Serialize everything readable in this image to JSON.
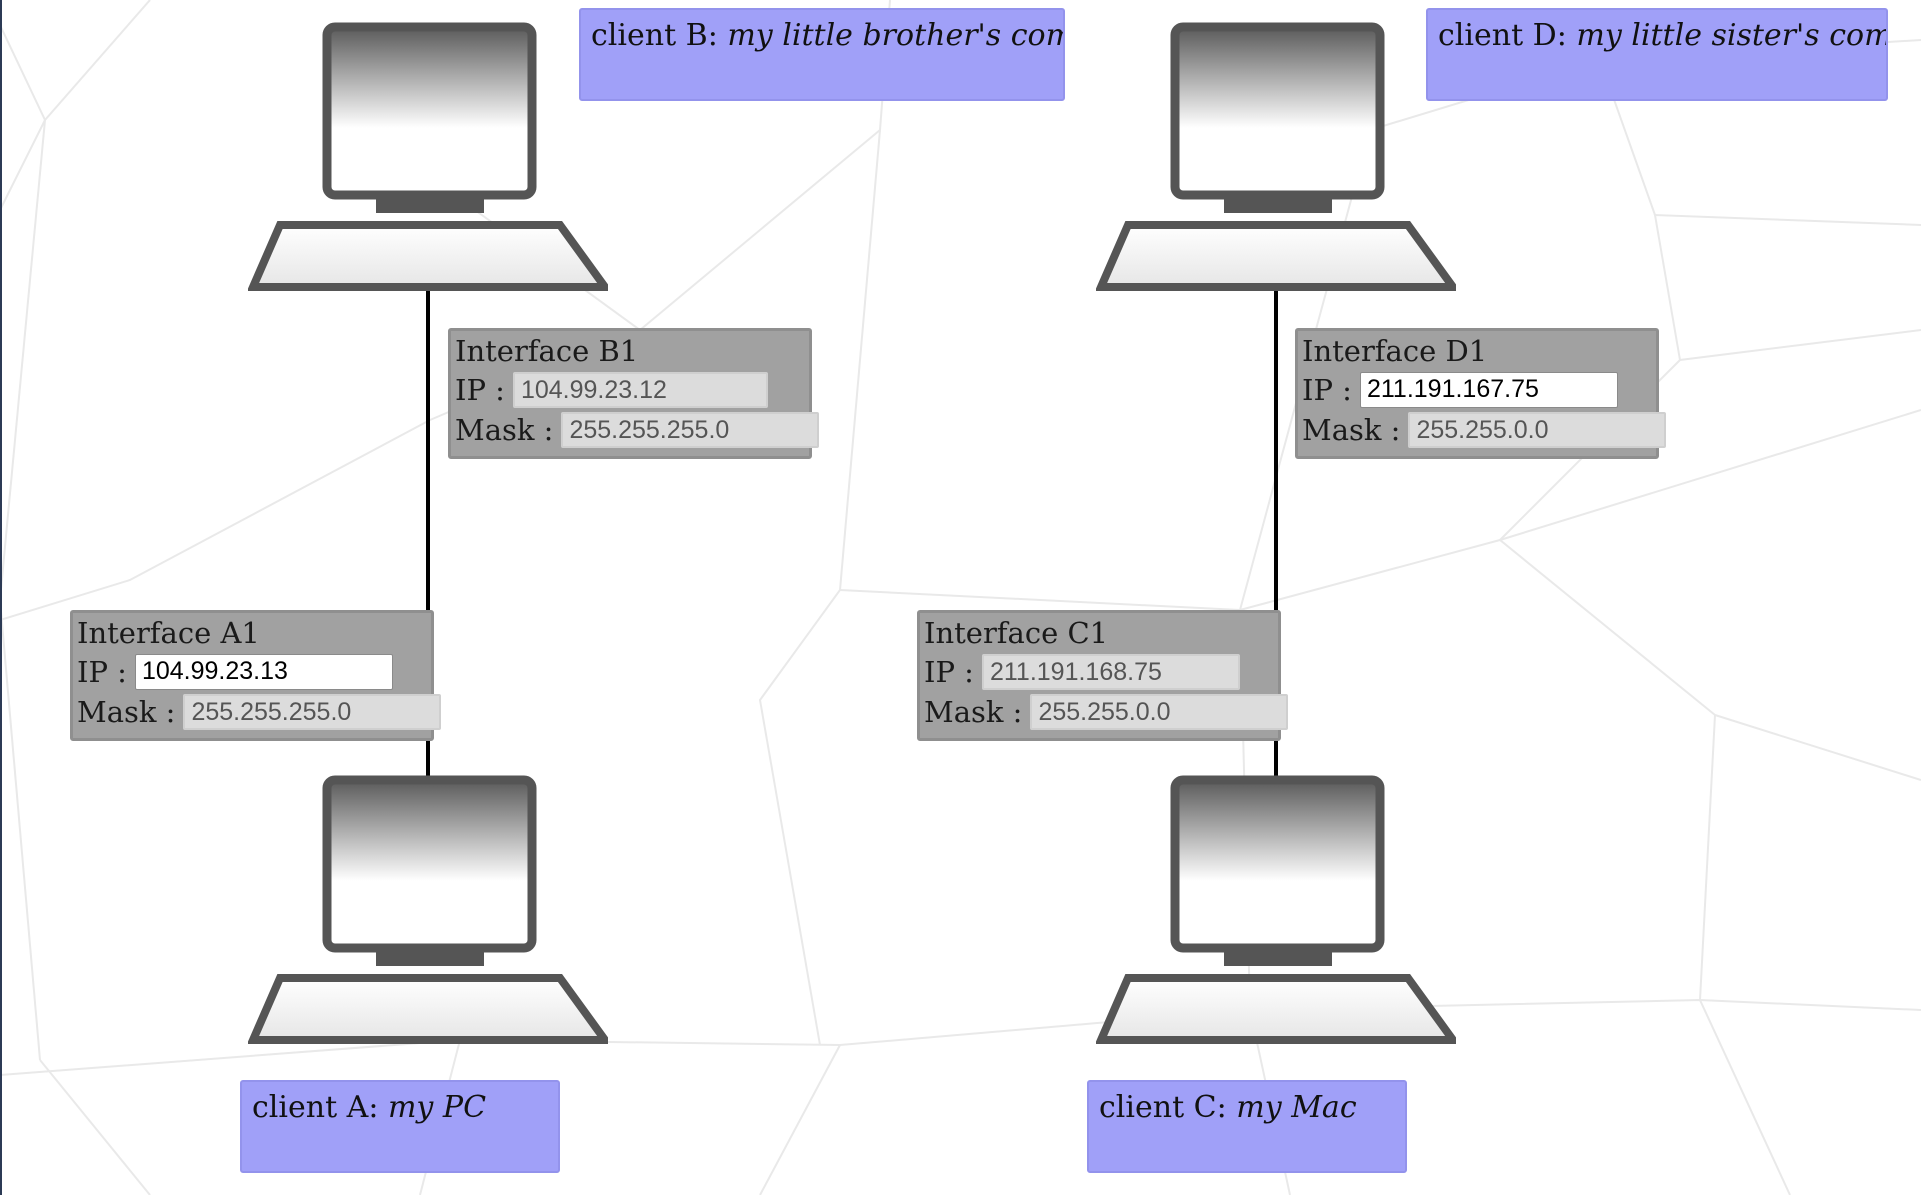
{
  "clients": {
    "a": {
      "prefix": "client A:",
      "desc": "my PC"
    },
    "b": {
      "prefix": "client B:",
      "desc": "my little brother's computer"
    },
    "c": {
      "prefix": "client C:",
      "desc": "my Mac"
    },
    "d": {
      "prefix": "client D:",
      "desc": "my little sister's computer"
    }
  },
  "interfaces": {
    "a1": {
      "title": "Interface A1",
      "ip_label": "IP :",
      "ip": "104.99.23.13",
      "ip_editable": true,
      "mask_label": "Mask :",
      "mask": "255.255.255.0"
    },
    "b1": {
      "title": "Interface B1",
      "ip_label": "IP :",
      "ip": "104.99.23.12",
      "ip_editable": false,
      "mask_label": "Mask :",
      "mask": "255.255.255.0"
    },
    "c1": {
      "title": "Interface C1",
      "ip_label": "IP :",
      "ip": "211.191.168.75",
      "ip_editable": false,
      "mask_label": "Mask :",
      "mask": "255.255.0.0"
    },
    "d1": {
      "title": "Interface D1",
      "ip_label": "IP :",
      "ip": "211.191.167.75",
      "ip_editable": true,
      "mask_label": "Mask :",
      "mask": "255.255.0.0"
    }
  },
  "colors": {
    "label_bg": "#a0a0f8",
    "interface_bg": "#a1a1a1",
    "computer_stroke": "#555555",
    "wire": "#000000"
  }
}
